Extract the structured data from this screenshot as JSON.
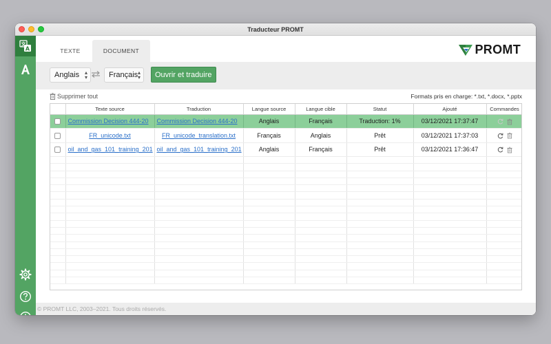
{
  "window": {
    "title": "Traducteur PROMT"
  },
  "sidebar": {
    "items": [
      {
        "name": "translate-icon"
      },
      {
        "name": "dictionary-icon"
      },
      {
        "name": "settings-icon"
      },
      {
        "name": "help-icon"
      },
      {
        "name": "info-icon"
      }
    ],
    "accent": "#53a463",
    "active_bg": "#2f7f3e"
  },
  "tabs": [
    {
      "label": "TEXTE"
    },
    {
      "label": "DOCUMENT",
      "active": true
    }
  ],
  "logo": {
    "text": "PROMT"
  },
  "toolbar": {
    "source_lang": "Anglais",
    "target_lang": "Français",
    "open_translate_label": "Ouvrir et traduire"
  },
  "actions": {
    "delete_all_label": "Supprimer tout",
    "formats_label": "Formats pris en charge: *.txt, *.docx, *.pptx"
  },
  "table": {
    "headers": [
      "",
      "Texte source",
      "Traduction",
      "Langue source",
      "Langue cible",
      "Statut",
      "Ajouté",
      "Commandes"
    ],
    "rows": [
      {
        "source": "Commission Decision 444-20",
        "translation": "Commission Decision 444-20",
        "src_lang": "Anglais",
        "tgt_lang": "Français",
        "status": "Traduction: 1%",
        "added": "03/12/2021 17:37:47",
        "selected": true
      },
      {
        "source": "FR_unicode.txt",
        "translation": "FR_unicode_translation.txt",
        "src_lang": "Français",
        "tgt_lang": "Anglais",
        "status": "Prêt",
        "added": "03/12/2021 17:37:03",
        "selected": false
      },
      {
        "source": "oil_and_gas_101_training_201",
        "translation": "oil_and_gas_101_training_201",
        "src_lang": "Anglais",
        "tgt_lang": "Français",
        "status": "Prêt",
        "added": "03/12/2021 17:36:47",
        "selected": false
      }
    ],
    "selected_row_color": "#8ccf9a",
    "link_color": "#2a6fc9"
  },
  "footer": {
    "copyright": "© PROMT LLC, 2003–2021. Tous droits réservés."
  }
}
